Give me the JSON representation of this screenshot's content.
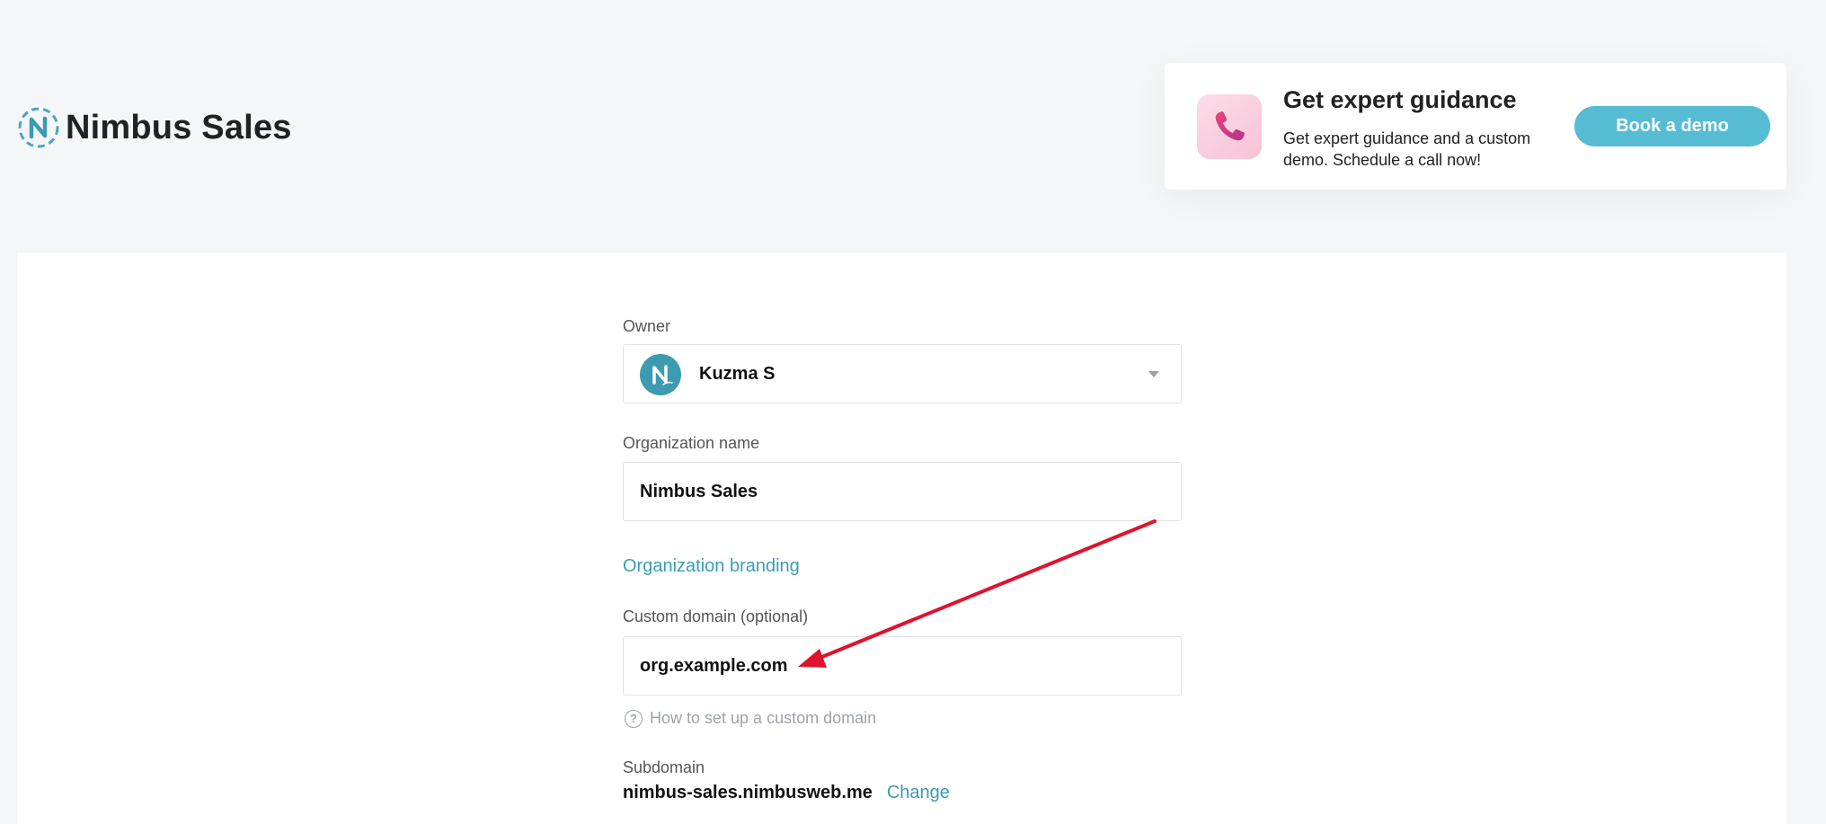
{
  "header": {
    "brand_name": "Nimbus Sales"
  },
  "promo": {
    "title": "Get expert guidance",
    "text": "Get expert guidance and a custom demo. Schedule a call now!",
    "button_label": "Book a demo",
    "icon": "phone-icon"
  },
  "form": {
    "owner": {
      "label": "Owner",
      "value": "Kuzma S"
    },
    "org_name": {
      "label": "Organization name",
      "value": "Nimbus Sales"
    },
    "branding_link": "Organization branding",
    "custom_domain": {
      "label": "Custom domain (optional)",
      "value": "org.example.com",
      "help_text": "How to set up a custom domain"
    },
    "subdomain": {
      "label": "Subdomain",
      "value": "nimbus-sales.nimbusweb.me",
      "change_label": "Change"
    }
  },
  "colors": {
    "accent": "#55bcd4",
    "link": "#3a9db5",
    "annotation_arrow": "#e0122e"
  }
}
